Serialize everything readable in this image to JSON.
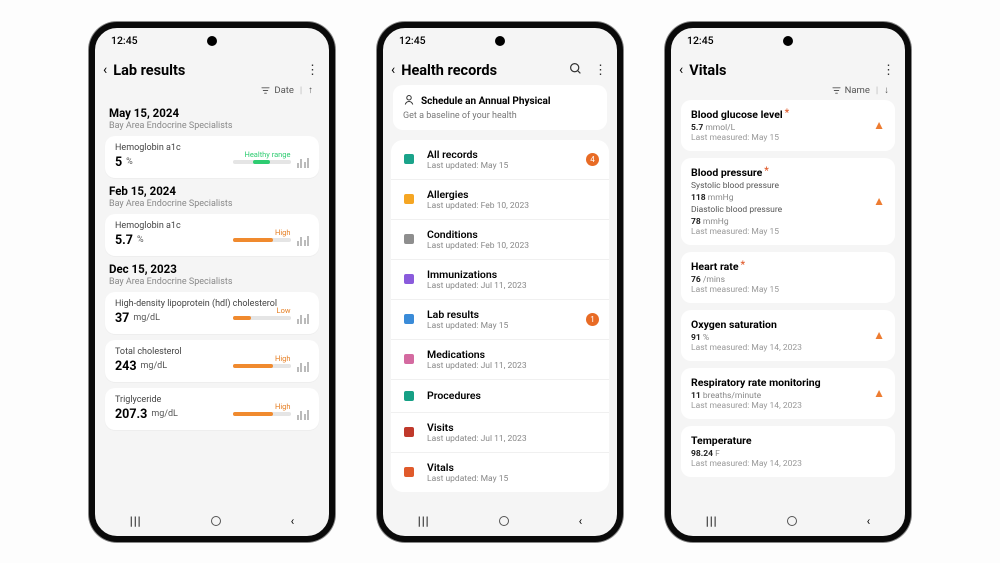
{
  "time": "12:45",
  "phone1": {
    "title": "Lab results",
    "sort_label": "Date",
    "groups": [
      {
        "date": "May 15, 2024",
        "sub": "Bay Area Endocrine Specialists",
        "cards": [
          {
            "label": "Hemoglobin a1c",
            "value": "5",
            "unit": "%",
            "status": "healthy",
            "status_label": "Healthy range"
          }
        ]
      },
      {
        "date": "Feb 15, 2024",
        "sub": "Bay Area Endocrine Specialists",
        "cards": [
          {
            "label": "Hemoglobin a1c",
            "value": "5.7",
            "unit": "%",
            "status": "high",
            "status_label": "High"
          }
        ]
      },
      {
        "date": "Dec 15, 2023",
        "sub": "Bay Area Endocrine Specialists",
        "cards": [
          {
            "label": "High-density lipoprotein (hdl) cholesterol",
            "value": "37",
            "unit": "mg/dL",
            "status": "low",
            "status_label": "Low"
          },
          {
            "label": "Total cholesterol",
            "value": "243",
            "unit": "mg/dL",
            "status": "high",
            "status_label": "High"
          },
          {
            "label": "Triglyceride",
            "value": "207.3",
            "unit": "mg/dL",
            "status": "high",
            "status_label": "High"
          }
        ]
      }
    ]
  },
  "phone2": {
    "title": "Health records",
    "banner_title": "Schedule an Annual Physical",
    "banner_sub": "Get a baseline of your health",
    "items": [
      {
        "icon": "teal",
        "t": "All records",
        "s": "Last updated: May 15",
        "badge": "4"
      },
      {
        "icon": "orange",
        "t": "Allergies",
        "s": "Last updated: Feb 10, 2023",
        "badge": ""
      },
      {
        "icon": "gray",
        "t": "Conditions",
        "s": "Last updated: Feb 10, 2023",
        "badge": ""
      },
      {
        "icon": "purple",
        "t": "Immunizations",
        "s": "Last updated: Jul 11, 2023",
        "badge": ""
      },
      {
        "icon": "blue",
        "t": "Lab results",
        "s": "Last updated: May 15",
        "badge": "1"
      },
      {
        "icon": "pill",
        "t": "Medications",
        "s": "Last updated: Jul 11, 2023",
        "badge": ""
      },
      {
        "icon": "doc",
        "t": "Procedures",
        "s": "",
        "badge": ""
      },
      {
        "icon": "pin",
        "t": "Visits",
        "s": "Last updated: Jul 11, 2023",
        "badge": ""
      },
      {
        "icon": "vitals",
        "t": "Vitals",
        "s": "Last updated: May 15",
        "badge": ""
      }
    ]
  },
  "phone3": {
    "title": "Vitals",
    "sort_label": "Name",
    "items": [
      {
        "t": "Blood glucose level",
        "star": true,
        "lines": [
          [
            "5.7",
            "mmol/L"
          ]
        ],
        "last": "Last measured: May 15",
        "warn": true
      },
      {
        "t": "Blood pressure",
        "star": true,
        "lines": [
          [
            "Systolic blood pressure",
            ""
          ],
          [
            "118",
            "mmHg"
          ],
          [
            "Diastolic blood pressure",
            ""
          ],
          [
            "78",
            "mmHg"
          ]
        ],
        "last": "Last measured: May 15",
        "warn": true
      },
      {
        "t": "Heart rate",
        "star": true,
        "lines": [
          [
            "76",
            "/mins"
          ]
        ],
        "last": "Last measured: May 15",
        "warn": false
      },
      {
        "t": "Oxygen saturation",
        "star": false,
        "lines": [
          [
            "91",
            "%"
          ]
        ],
        "last": "Last measured: May 14, 2023",
        "warn": true
      },
      {
        "t": "Respiratory rate monitoring",
        "star": false,
        "lines": [
          [
            "11",
            "breaths/minute"
          ]
        ],
        "last": "Last measured: May 14, 2023",
        "warn": true
      },
      {
        "t": "Temperature",
        "star": false,
        "lines": [
          [
            "98.24",
            "F"
          ]
        ],
        "last": "Last measured: May 14, 2023",
        "warn": false
      }
    ]
  }
}
